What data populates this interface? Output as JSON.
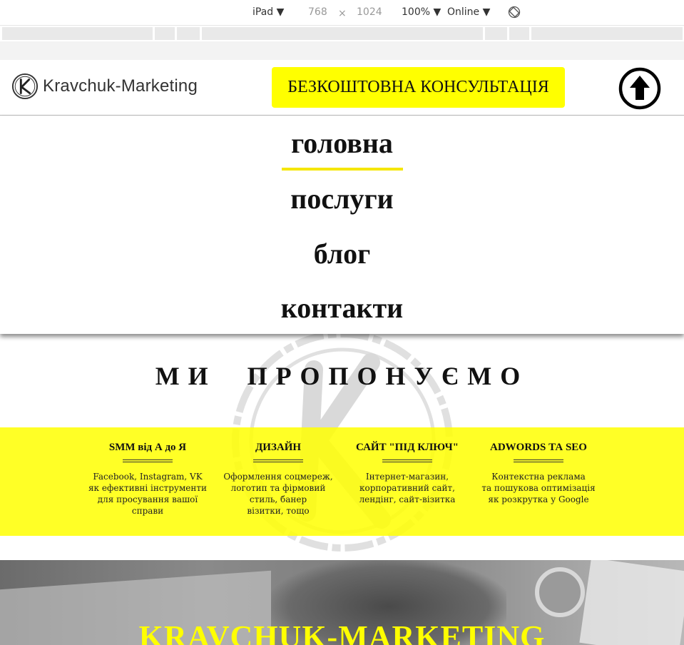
{
  "devtools": {
    "device": "iPad",
    "width": "768",
    "times": "×",
    "height": "1024",
    "zoom": "100%",
    "network": "Online",
    "arrow": "▼"
  },
  "header": {
    "logo_text": "Kravchuk-Marketing",
    "cta_label": "БЕЗКОШТОВНА КОНСУЛЬТАЦІЯ",
    "cta_color": "#ffff00"
  },
  "nav": {
    "items": [
      {
        "label": "головна",
        "active": true
      },
      {
        "label": "послуги"
      },
      {
        "label": "блог"
      },
      {
        "label": "контакти"
      }
    ],
    "active_color": "#f5e600"
  },
  "offer": {
    "title": "МИ ПРОПОНУЄМО",
    "services": [
      {
        "title": "SMM від А до Я",
        "lines": [
          "Facebook, Instagram, VK",
          "як ефективні інструменти",
          "для просування вашої",
          "справи"
        ]
      },
      {
        "title": "ДИЗАЙН",
        "lines": [
          "Оформлення соцмереж,",
          "логотип та фірмовий",
          "стиль, банер",
          "візитки, тощо"
        ]
      },
      {
        "title": "САЙТ \"ПІД КЛЮЧ\"",
        "lines": [
          "Інтернет-магазин,",
          "корпоративний сайт,",
          "лендінг, сайт-візитка"
        ]
      },
      {
        "title": "ADWORDS ТА SEO",
        "lines": [
          "Контекстна реклама",
          "та пошукова оптимізація",
          "як розкрутка у Google"
        ]
      }
    ]
  },
  "hero": {
    "title": "KRAVCHUK-MARKETING"
  }
}
